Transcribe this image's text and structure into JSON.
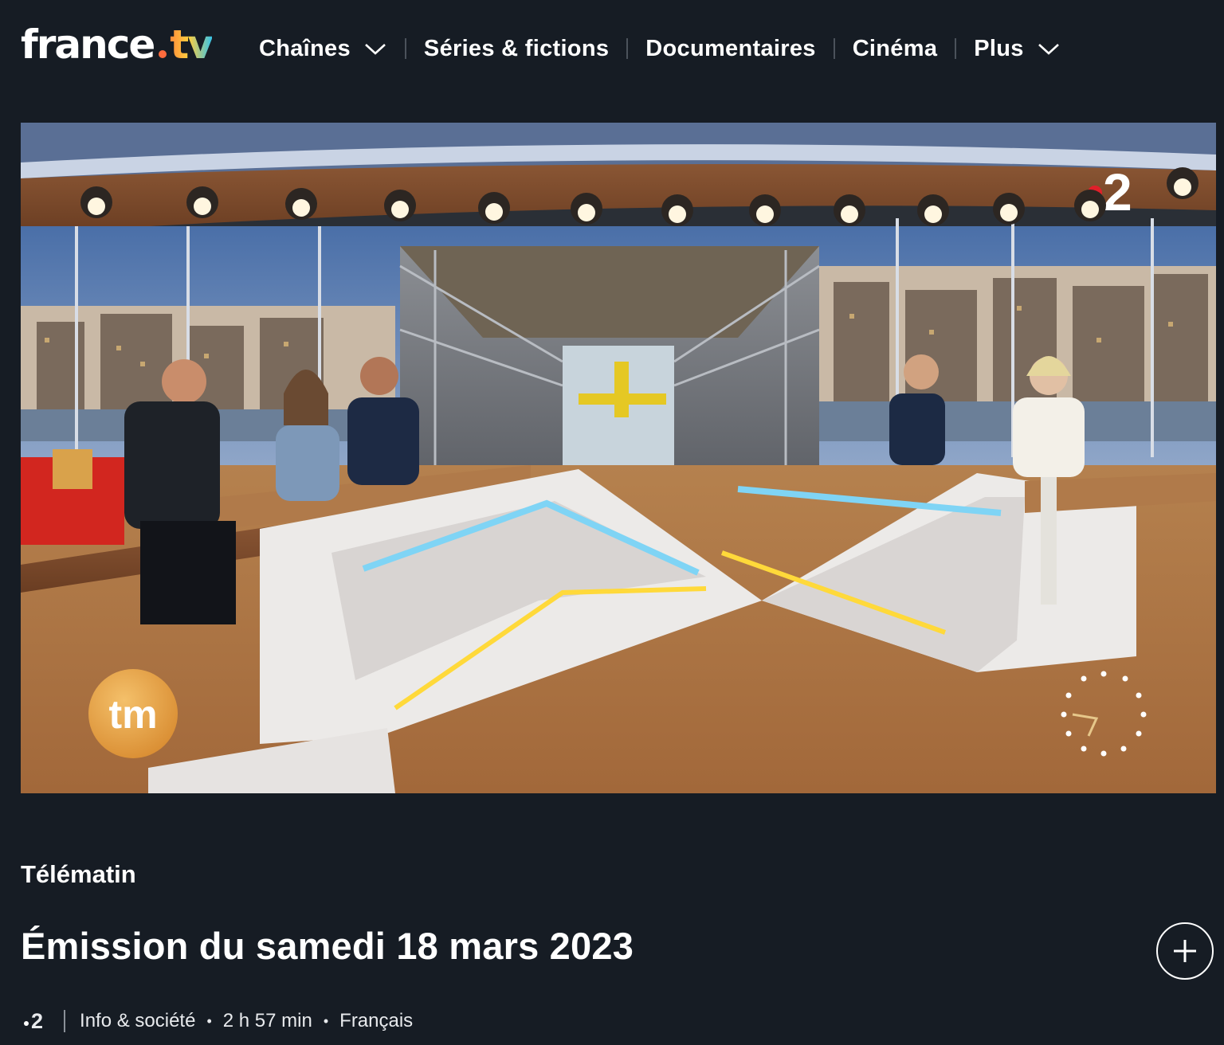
{
  "logo": {
    "word": "france",
    "suffix": "tv"
  },
  "nav": {
    "items": [
      {
        "label": "Chaînes",
        "has_dropdown": true
      },
      {
        "label": "Séries & fictions",
        "has_dropdown": false
      },
      {
        "label": "Documentaires",
        "has_dropdown": false
      },
      {
        "label": "Cinéma",
        "has_dropdown": false
      },
      {
        "label": "Plus",
        "has_dropdown": true
      }
    ]
  },
  "video": {
    "channel_bug": "2",
    "show_logo": "tm"
  },
  "program": {
    "show_title": "Télématin",
    "episode_title": "Émission du samedi 18 mars 2023",
    "channel": "2",
    "genre": "Info & société",
    "duration": "2 h 57 min",
    "language": "Français"
  },
  "colors": {
    "background": "#161c24",
    "logo_dot": "#ff6b3d",
    "tm_logo": "#e8a54a"
  },
  "icons": {
    "add": "plus-icon",
    "dropdown": "chevron-down-icon"
  }
}
